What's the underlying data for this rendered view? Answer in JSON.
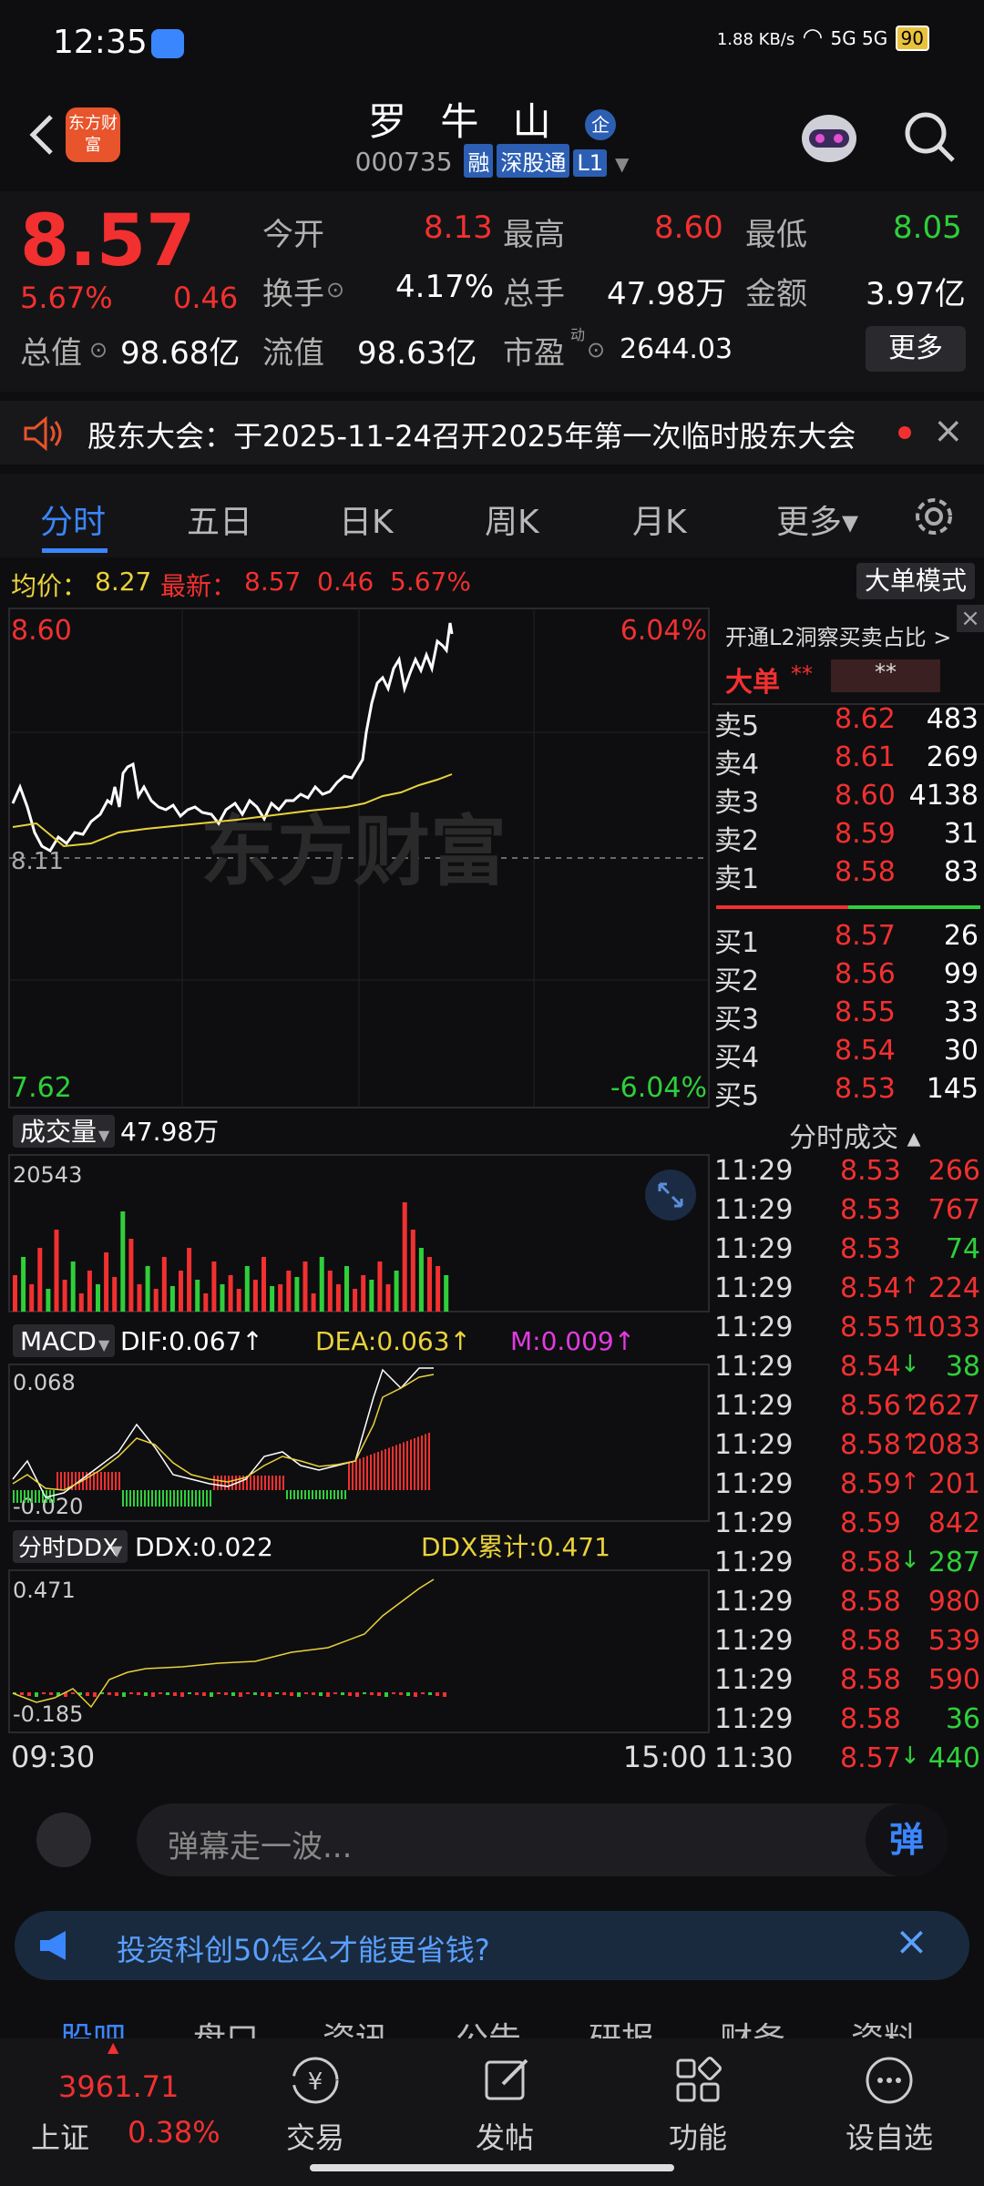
{
  "status": {
    "time": "12:35",
    "net_speed": "1.88 KB/s",
    "signal": "5G 5G",
    "battery": "90"
  },
  "header": {
    "name": "罗 牛 山",
    "code": "000735",
    "tags": [
      "融",
      "深股通",
      "L1"
    ],
    "logo_text": "东方财富",
    "corp_badge": "企"
  },
  "quote": {
    "price": "8.57",
    "pct": "5.67%",
    "chg": "0.46",
    "open_label": "今开",
    "open": "8.13",
    "high_label": "最高",
    "high": "8.60",
    "low_label": "最低",
    "low": "8.05",
    "turnover_label": "换手",
    "turnover": "4.17%",
    "volume_label": "总手",
    "volume": "47.98万",
    "amount_label": "金额",
    "amount": "3.97亿",
    "mcap_label": "总值",
    "mcap": "98.68亿",
    "float_label": "流值",
    "float": "98.63亿",
    "pe_label": "市盈",
    "pe_sup": "动",
    "pe": "2644.03",
    "more": "更多"
  },
  "notice": {
    "text": "股东大会：于2025-11-24召开2025年第一次临时股东大会"
  },
  "tabs": [
    "分时",
    "五日",
    "日K",
    "周K",
    "月K",
    "更多▾"
  ],
  "infobar": {
    "avg_label": "均价：",
    "avg": "8.27",
    "last_label": "最新：",
    "last": "8.57",
    "chg": "0.46",
    "pct": "5.67%",
    "big_order": "大单模式"
  },
  "price_chart": {
    "y_top": "8.60",
    "y_bottom": "7.62",
    "pct_top": "6.04%",
    "pct_bottom": "-6.04%",
    "mid_label": "8.11",
    "watermark": "东方财富"
  },
  "volume_chart": {
    "label": "成交量",
    "total": "47.98万",
    "max": "20543"
  },
  "macd_chart": {
    "label": "MACD",
    "dif": "DIF:0.067↑",
    "dea": "DEA:0.063↑",
    "m": "M:0.009↑",
    "max": "0.068",
    "min": "-0.020"
  },
  "ddx_chart": {
    "label": "分时DDX",
    "ddx": "DDX:0.022",
    "ddx_cum": "DDX累计:0.471",
    "max": "0.471",
    "min": "-0.185"
  },
  "time_axis": {
    "start": "09:30",
    "end": "15:00"
  },
  "order_book": {
    "l2_banner": "开通L2洞察买卖占比 >",
    "big_label": "大单",
    "big_val1": "**",
    "big_val2": "**",
    "asks": [
      {
        "label": "卖5",
        "price": "8.62",
        "vol": "483"
      },
      {
        "label": "卖4",
        "price": "8.61",
        "vol": "269"
      },
      {
        "label": "卖3",
        "price": "8.60",
        "vol": "4138"
      },
      {
        "label": "卖2",
        "price": "8.59",
        "vol": "31"
      },
      {
        "label": "卖1",
        "price": "8.58",
        "vol": "83"
      }
    ],
    "bids": [
      {
        "label": "买1",
        "price": "8.57",
        "vol": "26"
      },
      {
        "label": "买2",
        "price": "8.56",
        "vol": "99"
      },
      {
        "label": "买3",
        "price": "8.55",
        "vol": "33"
      },
      {
        "label": "买4",
        "price": "8.54",
        "vol": "30"
      },
      {
        "label": "买5",
        "price": "8.53",
        "vol": "145"
      }
    ],
    "ticks_title": "分时成交 ▴",
    "ticks": [
      {
        "time": "11:29",
        "price": "8.53",
        "vol": "266",
        "dir": "",
        "color": "red"
      },
      {
        "time": "11:29",
        "price": "8.53",
        "vol": "767",
        "dir": "",
        "color": "red"
      },
      {
        "time": "11:29",
        "price": "8.53",
        "vol": "74",
        "dir": "",
        "color": "green"
      },
      {
        "time": "11:29",
        "price": "8.54",
        "vol": "224",
        "dir": "↑",
        "color": "red"
      },
      {
        "time": "11:29",
        "price": "8.55",
        "vol": "1033",
        "dir": "↑",
        "color": "red"
      },
      {
        "time": "11:29",
        "price": "8.54",
        "vol": "38",
        "dir": "↓",
        "color": "green"
      },
      {
        "time": "11:29",
        "price": "8.56",
        "vol": "2627",
        "dir": "↑",
        "color": "red"
      },
      {
        "time": "11:29",
        "price": "8.58",
        "vol": "2083",
        "dir": "↑",
        "color": "red"
      },
      {
        "time": "11:29",
        "price": "8.59",
        "vol": "201",
        "dir": "↑",
        "color": "red"
      },
      {
        "time": "11:29",
        "price": "8.59",
        "vol": "842",
        "dir": "",
        "color": "red"
      },
      {
        "time": "11:29",
        "price": "8.58",
        "vol": "287",
        "dir": "↓",
        "color": "green"
      },
      {
        "time": "11:29",
        "price": "8.58",
        "vol": "980",
        "dir": "",
        "color": "red"
      },
      {
        "time": "11:29",
        "price": "8.58",
        "vol": "539",
        "dir": "",
        "color": "red"
      },
      {
        "time": "11:29",
        "price": "8.58",
        "vol": "590",
        "dir": "",
        "color": "red"
      },
      {
        "time": "11:29",
        "price": "8.58",
        "vol": "36",
        "dir": "",
        "color": "green"
      },
      {
        "time": "11:30",
        "price": "8.57",
        "vol": "440",
        "dir": "↓",
        "color": "green"
      }
    ]
  },
  "danmu": {
    "placeholder": "弹幕走一波...",
    "button": "弹"
  },
  "ad": {
    "text": "投资科创50怎么才能更省钱?"
  },
  "sub_tabs": [
    "股吧",
    "盘口",
    "资讯",
    "公告",
    "研报",
    "财务",
    "资料"
  ],
  "bottom_nav": {
    "index_value": "3961.71",
    "index_name": "上证",
    "index_pct": "0.38%",
    "items": [
      "交易",
      "发帖",
      "功能",
      "设自选"
    ]
  },
  "colors": {
    "up": "#f23030",
    "down": "#2fcf3a",
    "accent": "#3a86ff",
    "avg_line": "#e9d23c"
  }
}
